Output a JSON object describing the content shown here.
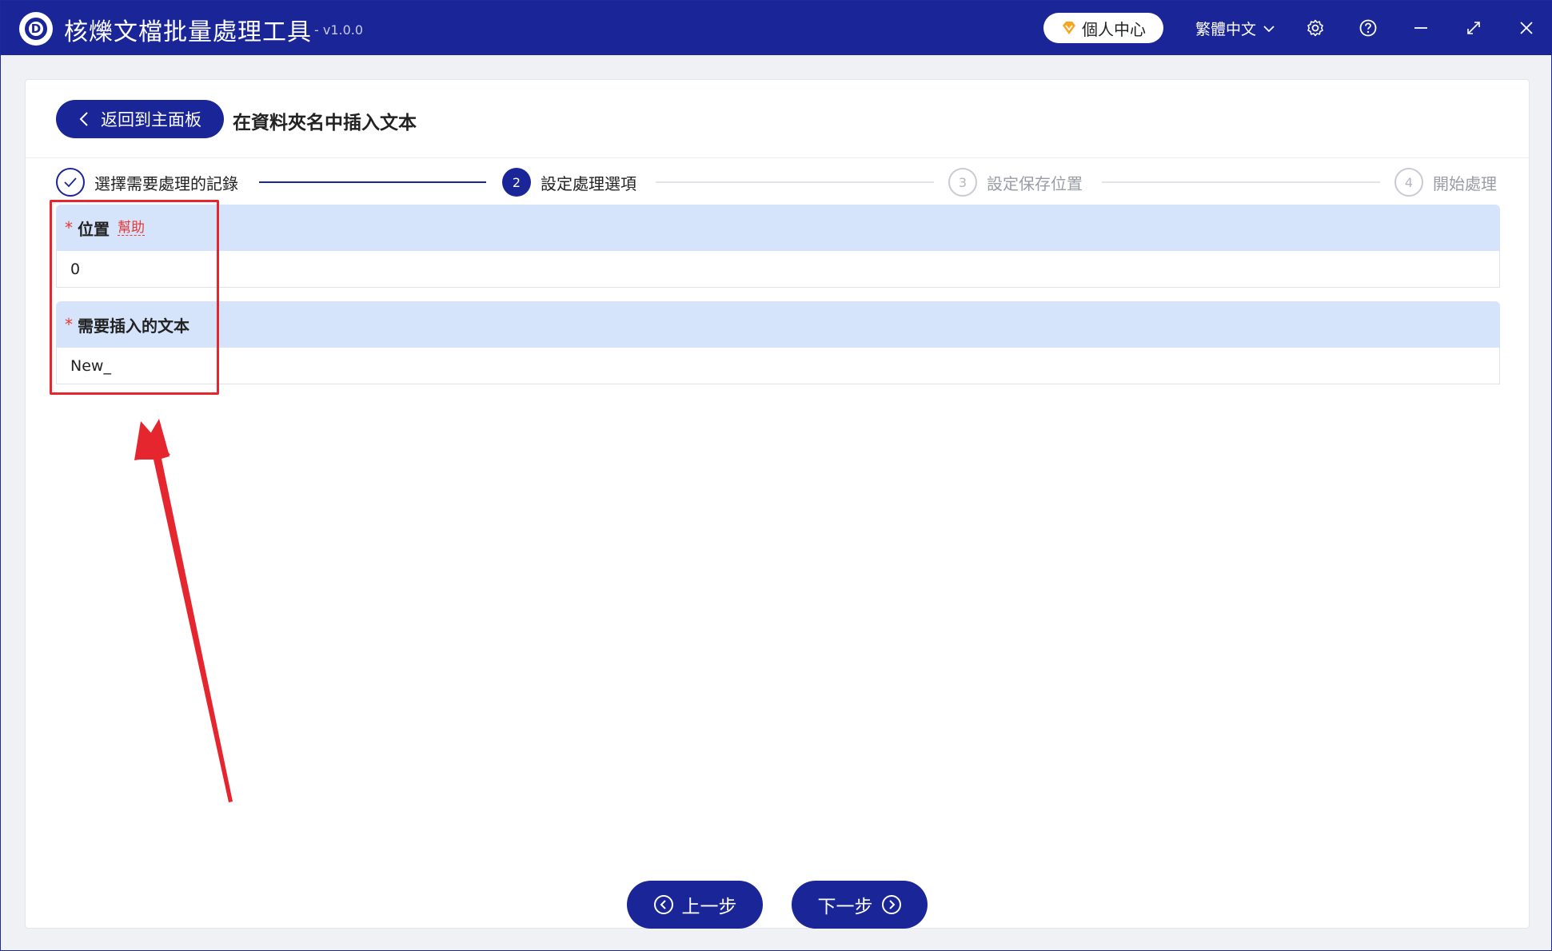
{
  "app": {
    "title": "核爍文檔批量處理工具",
    "version": "- v1.0.0",
    "user_center": "個人中心",
    "language": "繁體中文"
  },
  "header": {
    "back_label": "返回到主面板",
    "page_title": "在資料夾名中插入文本"
  },
  "steps": [
    {
      "number": "✓",
      "label": "選擇需要處理的記錄",
      "state": "done"
    },
    {
      "number": "2",
      "label": "設定處理選項",
      "state": "active"
    },
    {
      "number": "3",
      "label": "設定保存位置",
      "state": "pending"
    },
    {
      "number": "4",
      "label": "開始處理",
      "state": "pending"
    }
  ],
  "form": {
    "position": {
      "required": "*",
      "label": "位置",
      "help": "幫助",
      "value": "0"
    },
    "text_to_insert": {
      "required": "*",
      "label": "需要插入的文本",
      "value": "New_"
    }
  },
  "footer": {
    "prev_label": "上一步",
    "next_label": "下一步"
  },
  "colors": {
    "primary": "#1a2597",
    "field_header": "#d6e4fb",
    "annotation": "#e5262f",
    "badge": "#f5a623"
  }
}
